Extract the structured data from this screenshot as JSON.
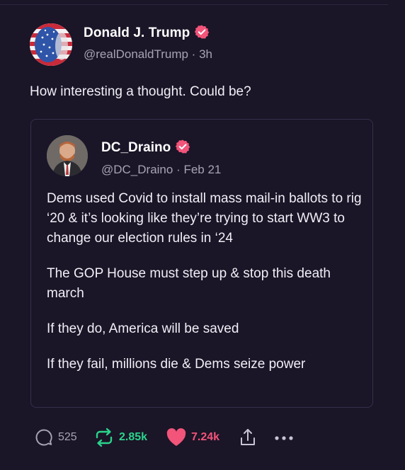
{
  "post": {
    "author_name": "Donald J. Trump",
    "author_meta": "@realDonaldTrump · 3h",
    "text": "How interesting a thought. Could be?"
  },
  "quoted": {
    "author_name": "DC_Draino",
    "author_meta": "@DC_Draino · Feb 21",
    "paragraphs": [
      "Dems used Covid to install mass mail-in ballots to rig ‘20 & it’s looking like they’re trying to start WW3 to change our election rules in ‘24",
      "The GOP House must step up & stop this death march",
      "If they do, America will be saved",
      "If they fail, millions die & Dems seize power"
    ]
  },
  "actions": {
    "replies": "525",
    "retruths": "2.85k",
    "likes": "7.24k"
  },
  "colors": {
    "background": "#1a1527",
    "verified": "#f2547a",
    "retruth": "#2bd38c",
    "like": "#f2547a"
  },
  "icons": [
    "verified-badge-icon",
    "reply-icon",
    "retruth-icon",
    "heart-icon",
    "share-icon",
    "more-icon"
  ]
}
